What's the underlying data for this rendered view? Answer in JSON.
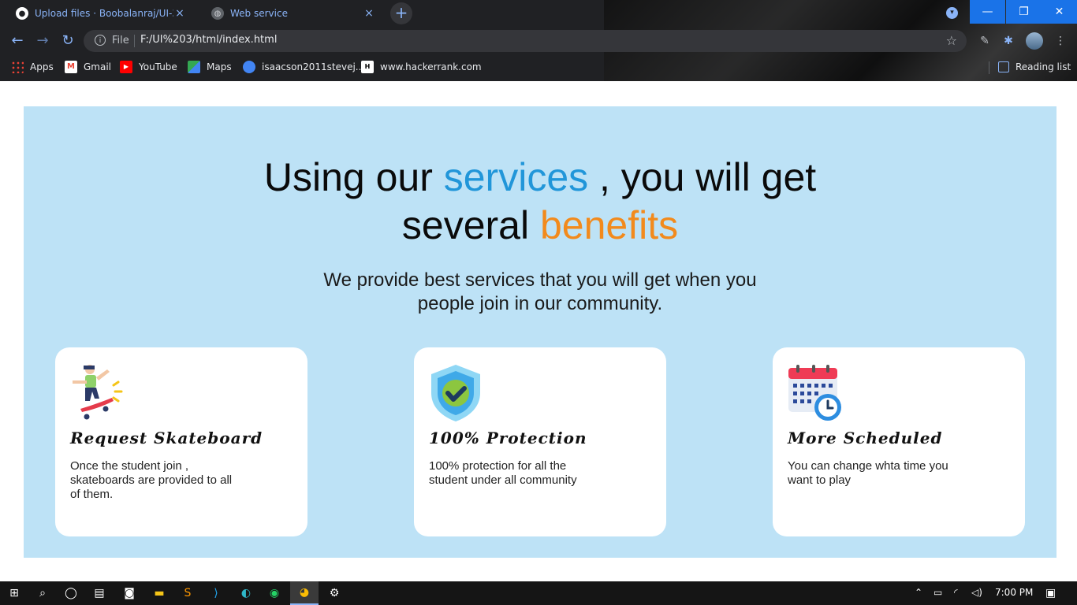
{
  "browser": {
    "tabs": [
      {
        "title": "Upload files · Boobalanraj/UI-3",
        "close": "×"
      },
      {
        "title": "Web service",
        "close": "×"
      }
    ],
    "new_tab": "+",
    "window": {
      "minimize": "—",
      "maximize": "❐",
      "close": "✕"
    },
    "nav": {
      "back": "←",
      "forward": "→",
      "reload": "↻"
    },
    "omnibox": {
      "scheme_label": "File",
      "url": "F:/UI%203/html/index.html",
      "info_glyph": "i",
      "star": "☆"
    },
    "bookmarks": [
      {
        "label": "Apps",
        "icon": "apps-grid-icon"
      },
      {
        "label": "Gmail",
        "icon": "gmail-icon",
        "glyph": "M"
      },
      {
        "label": "YouTube",
        "icon": "youtube-icon",
        "glyph": "▶"
      },
      {
        "label": "Maps",
        "icon": "maps-icon"
      },
      {
        "label": "isaacson2011stevej...",
        "icon": "globe-icon"
      },
      {
        "label": "www.hackerrank.com",
        "icon": "hackerrank-icon",
        "glyph": "H"
      }
    ],
    "reading_list": "Reading list"
  },
  "hero": {
    "line1_pre": "Using our ",
    "line1_highlight": "services",
    "line1_post": " , you will get",
    "line2_pre": "several ",
    "line2_highlight": "benefits",
    "subtitle_line1": "We provide best services that you will get when you",
    "subtitle_line2": "people join in our community.",
    "highlight_blue": "#2196d9",
    "highlight_orange": "#f28a1c"
  },
  "cards": [
    {
      "title": "Request Skateboard",
      "text": "Once the student join , skateboards are provided to all of them.",
      "icon": "skateboarder-icon"
    },
    {
      "title": "100% Protection",
      "text": "100% protection for all the student under all community",
      "icon": "shield-check-icon"
    },
    {
      "title": "More Scheduled",
      "text": "You can change whta time you want to play",
      "icon": "calendar-clock-icon"
    }
  ],
  "taskbar": {
    "clock": "7:00 PM"
  },
  "colors": {
    "panel_bg": "#bde2f6",
    "card_bg": "#ffffff",
    "chrome_bg": "#202124"
  }
}
